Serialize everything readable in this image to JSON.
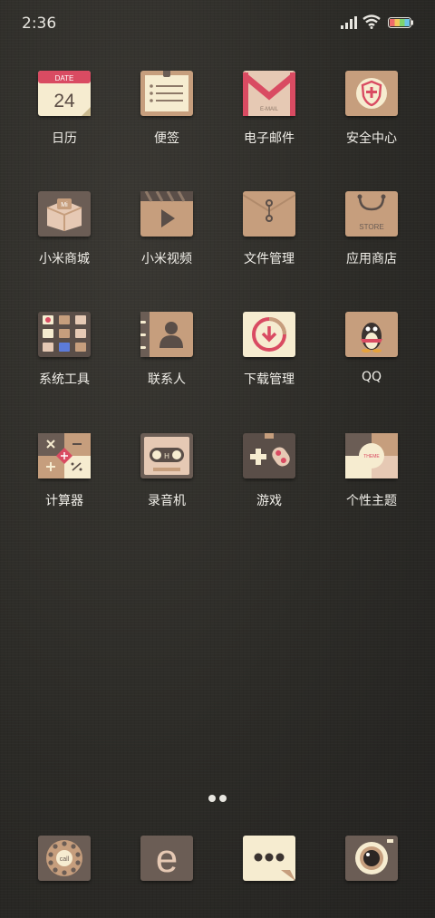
{
  "status": {
    "time": "2:36"
  },
  "apps": [
    {
      "label": "日历",
      "icon": "calendar-icon",
      "date_label": "DATE",
      "date_value": "24"
    },
    {
      "label": "便签",
      "icon": "notes-icon"
    },
    {
      "label": "电子邮件",
      "icon": "email-icon",
      "caption": "E-MAIL"
    },
    {
      "label": "安全中心",
      "icon": "security-icon"
    },
    {
      "label": "小米商城",
      "icon": "mi-store-icon",
      "caption": "Mi"
    },
    {
      "label": "小米视频",
      "icon": "video-icon"
    },
    {
      "label": "文件管理",
      "icon": "file-manager-icon"
    },
    {
      "label": "应用商店",
      "icon": "app-store-icon",
      "caption": "STORE"
    },
    {
      "label": "系统工具",
      "icon": "system-tools-folder-icon"
    },
    {
      "label": "联系人",
      "icon": "contacts-icon"
    },
    {
      "label": "下载管理",
      "icon": "download-icon"
    },
    {
      "label": "QQ",
      "icon": "qq-icon"
    },
    {
      "label": "计算器",
      "icon": "calculator-icon"
    },
    {
      "label": "录音机",
      "icon": "recorder-icon",
      "caption": "H"
    },
    {
      "label": "游戏",
      "icon": "game-icon"
    },
    {
      "label": "个性主题",
      "icon": "theme-icon",
      "caption": "THEME"
    }
  ],
  "dock": [
    {
      "icon": "phone-icon",
      "caption": "call"
    },
    {
      "icon": "browser-icon",
      "caption": "e"
    },
    {
      "icon": "messages-icon"
    },
    {
      "icon": "camera-icon"
    }
  ],
  "pager": {
    "pages": 2,
    "current": 1
  }
}
